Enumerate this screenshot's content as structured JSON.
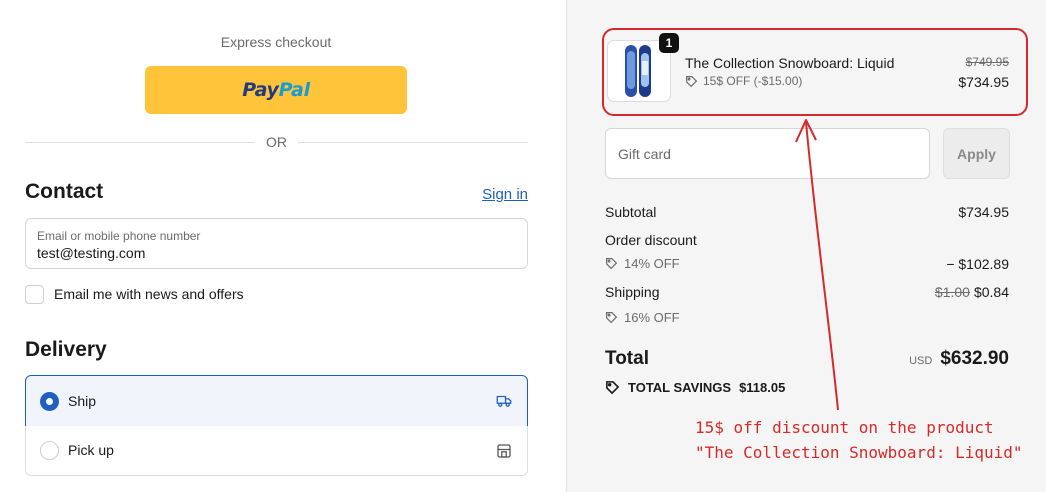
{
  "express": {
    "title": "Express checkout",
    "paypal_pay": "Pay",
    "paypal_pal": "Pal",
    "or_text": "OR"
  },
  "contact": {
    "title": "Contact",
    "signin_label": "Sign in",
    "email_label": "Email or mobile phone number",
    "email_value": "test@testing.com",
    "news_label": "Email me with news and offers",
    "news_checked": false
  },
  "delivery": {
    "title": "Delivery",
    "options": [
      {
        "label": "Ship",
        "selected": true,
        "icon": "truck-icon"
      },
      {
        "label": "Pick up",
        "selected": false,
        "icon": "store-icon"
      }
    ]
  },
  "summary": {
    "product": {
      "quantity": "1",
      "name": "The Collection Snowboard: Liquid",
      "discount": "15$ OFF (-$15.00)",
      "original_price": "$749.95",
      "price": "$734.95"
    },
    "gift_card": {
      "placeholder": "Gift card",
      "apply_label": "Apply"
    },
    "subtotal_label": "Subtotal",
    "subtotal_value": "$734.95",
    "order_discount_label": "Order discount",
    "order_discount_code": "14% OFF",
    "order_discount_value": "− $102.89",
    "shipping_label": "Shipping",
    "shipping_old": "$1.00",
    "shipping_value": "$0.84",
    "shipping_discount": "16% OFF",
    "total_label": "Total",
    "currency": "USD",
    "total_value": "$632.90",
    "savings_label": "TOTAL SAVINGS",
    "savings_value": "$118.05"
  },
  "annotation": {
    "line1": "15$ off discount on the product",
    "line2": "\"The Collection Snowboard: Liquid\"",
    "color": "#d62a2a"
  },
  "colors": {
    "accent": "#1f5fbf",
    "paypal_yellow": "#ffc439",
    "summary_bg": "#f5f5f5"
  }
}
